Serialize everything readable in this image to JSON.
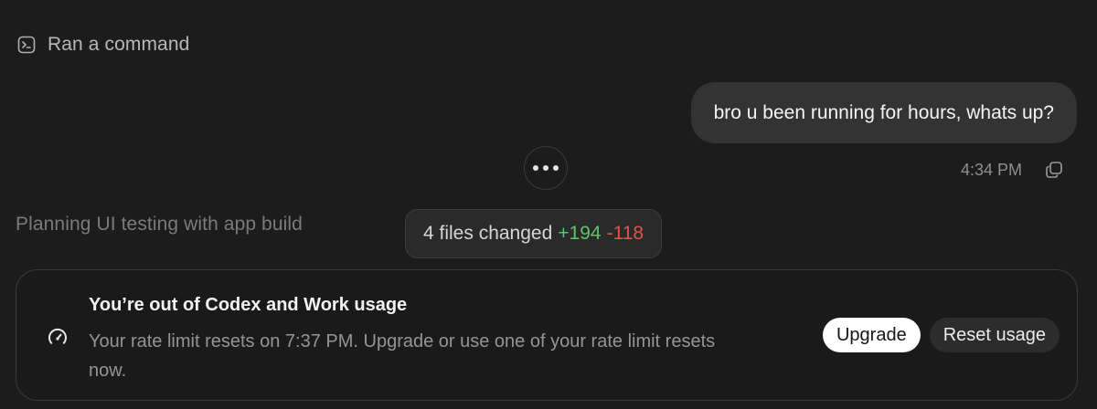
{
  "activity": {
    "command_label": "Ran a command",
    "status_text": "Planning UI testing with app build"
  },
  "user_message": {
    "text": "bro u been running for hours, whats up?",
    "timestamp": "4:34 PM"
  },
  "changes": {
    "label": "4 files changed",
    "added": "+194",
    "removed": "-118",
    "added_color": "#5ec46d",
    "removed_color": "#e0524c"
  },
  "usage_notice": {
    "title": "You’re out of Codex and Work usage",
    "body": "Your rate limit resets on 7:37 PM. Upgrade or use one of your rate limit resets now.",
    "upgrade_label": "Upgrade",
    "reset_label": "Reset usage"
  },
  "icons": {
    "command": "terminal-icon",
    "copy": "copy-icon",
    "more": "more-icon",
    "usage": "gauge-icon"
  }
}
